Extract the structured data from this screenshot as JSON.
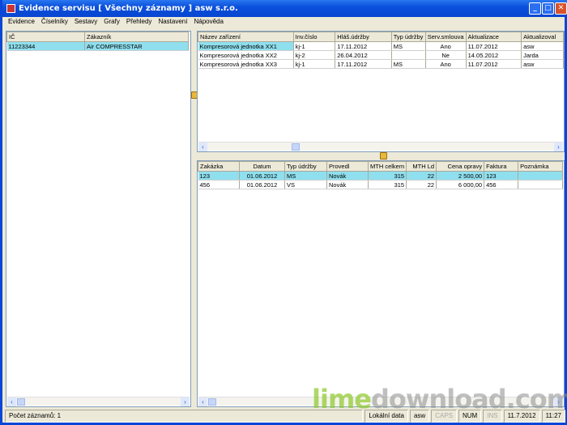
{
  "window": {
    "title": "Evidence servisu [ Všechny záznamy ]   asw s.r.o."
  },
  "menu": [
    "Evidence",
    "Číselníky",
    "Sestavy",
    "Grafy",
    "Přehledy",
    "Nastavení",
    "Nápověda"
  ],
  "customers": {
    "headers": [
      "IČ",
      "Zákazník"
    ],
    "rows": [
      [
        "11223344",
        "Air COMPRESSTAR"
      ]
    ]
  },
  "devices": {
    "headers": [
      "Název zařízení",
      "Inv.číslo",
      "Hláš.údržby",
      "Typ údržby",
      "Serv.smlouva",
      "Aktualizace",
      "Aktualizoval"
    ],
    "rows": [
      [
        "Kompresorová jednotka XX1",
        "kj-1",
        "17.11.2012",
        "MS",
        "Ano",
        "11.07.2012",
        "asw"
      ],
      [
        "Kompresorová jednotka XX2",
        "kj-2",
        "26.04.2012",
        "",
        "Ne",
        "14.05.2012",
        "Jarda"
      ],
      [
        "Kompresorová jednotka XX3",
        "kj-1",
        "17.11.2012",
        "MS",
        "Ano",
        "11.07.2012",
        "asw"
      ]
    ]
  },
  "orders": {
    "headers": [
      "Zakázka",
      "Datum",
      "Typ údržby",
      "Provedl",
      "MTH celkem",
      "MTH Ld",
      "Cena opravy",
      "Faktura",
      "Poznámka"
    ],
    "rows": [
      [
        "123",
        "01.06.2012",
        "MS",
        "Novák",
        "315",
        "22",
        "2 500,00",
        "123",
        ""
      ],
      [
        "456",
        "01.06.2012",
        "VS",
        "Novák",
        "315",
        "22",
        "6 000,00",
        "456",
        ""
      ]
    ]
  },
  "status": {
    "count": "Počet záznamů: 1",
    "data": "Lokální data",
    "user": "asw",
    "caps": "CAPS",
    "num": "NUM",
    "ins": "INS",
    "date": "11.7.2012",
    "time": "11:27"
  },
  "watermark": {
    "a": "lime",
    "b": "download.com"
  },
  "colors": {
    "selection": "#8fdfee",
    "titlebar": "#0a50dc"
  }
}
